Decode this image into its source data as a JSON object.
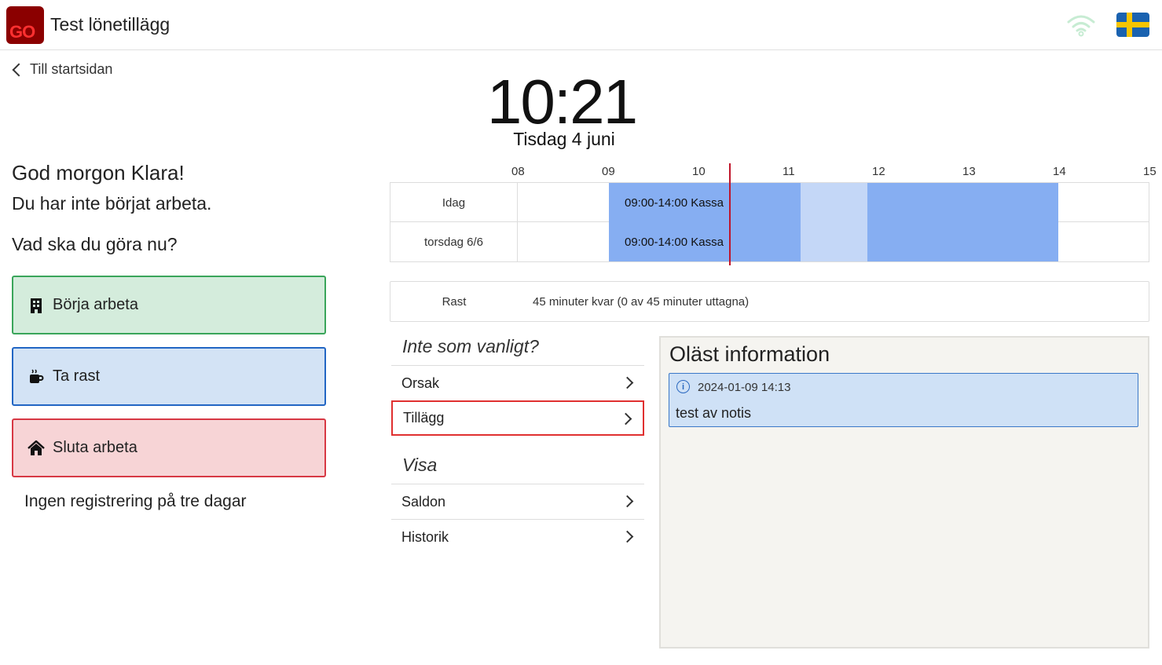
{
  "header": {
    "logo_text": "GO",
    "title": "Test lönetillägg",
    "wifi_icon": "wifi-icon",
    "language_icon": "swedish-flag-icon"
  },
  "nav": {
    "back_label": "Till startsidan"
  },
  "clock": {
    "time": "10:21",
    "date": "Tisdag 4 juni"
  },
  "left": {
    "greeting": "God morgon Klara!",
    "status": "Du har inte börjat arbeta.",
    "question": "Vad ska du göra nu?",
    "actions": [
      {
        "label": "Börja arbeta",
        "icon": "building-icon",
        "color": "#d4ecdc"
      },
      {
        "label": "Ta rast",
        "icon": "coffee-cup-icon",
        "color": "#d3e3f5"
      },
      {
        "label": "Sluta arbeta",
        "icon": "house-icon",
        "color": "#f7d4d6"
      }
    ],
    "no_registration": "Ingen registrering på tre dagar"
  },
  "schedule": {
    "hours": [
      "08",
      "09",
      "10",
      "11",
      "12",
      "13",
      "14",
      "15"
    ],
    "rows": [
      {
        "label": "Idag",
        "shift_label": "09:00-14:00 Kassa"
      },
      {
        "label": "torsdag 6/6",
        "shift_label": "09:00-14:00 Kassa"
      }
    ],
    "shift_color": "#86aef2",
    "break_color": "#c4d7f7",
    "now_line_color": "#c0152b"
  },
  "rast": {
    "label": "Rast",
    "text": "45 minuter kvar (0 av 45 minuter uttagna)"
  },
  "menu": {
    "unusual_heading": "Inte som vanligt?",
    "unusual_items": [
      "Orsak",
      "Tillägg"
    ],
    "show_heading": "Visa",
    "show_items": [
      "Saldon",
      "Historik"
    ]
  },
  "info": {
    "title": "Oläst information",
    "notices": [
      {
        "time": "2024-01-09 14:13",
        "text": "test av notis",
        "icon": "info-icon"
      }
    ]
  }
}
